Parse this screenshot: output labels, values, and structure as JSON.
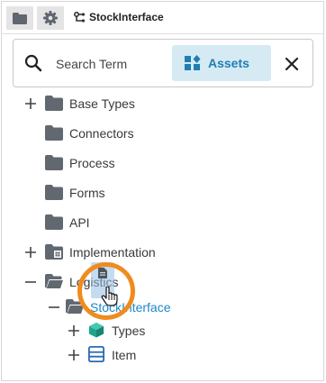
{
  "breadcrumb": {
    "label": "StockInterface"
  },
  "search": {
    "placeholder": "Search Term",
    "assets_label": "Assets"
  },
  "tree": {
    "base_types": "Base Types",
    "connectors": "Connectors",
    "process": "Process",
    "forms": "Forms",
    "api": "API",
    "implementation": "Implementation",
    "logistics": "Logistics",
    "stockinterface": "StockInterface",
    "types": "Types",
    "item": "Item"
  },
  "colors": {
    "accent": "#1f7fb3",
    "assets_bg": "#d6eaf4",
    "folder": "#616870",
    "link": "#1e88c8",
    "types_icon": "#1fa58c",
    "item_icon": "#2a6ab5",
    "drag_ring": "#f08b1e"
  }
}
